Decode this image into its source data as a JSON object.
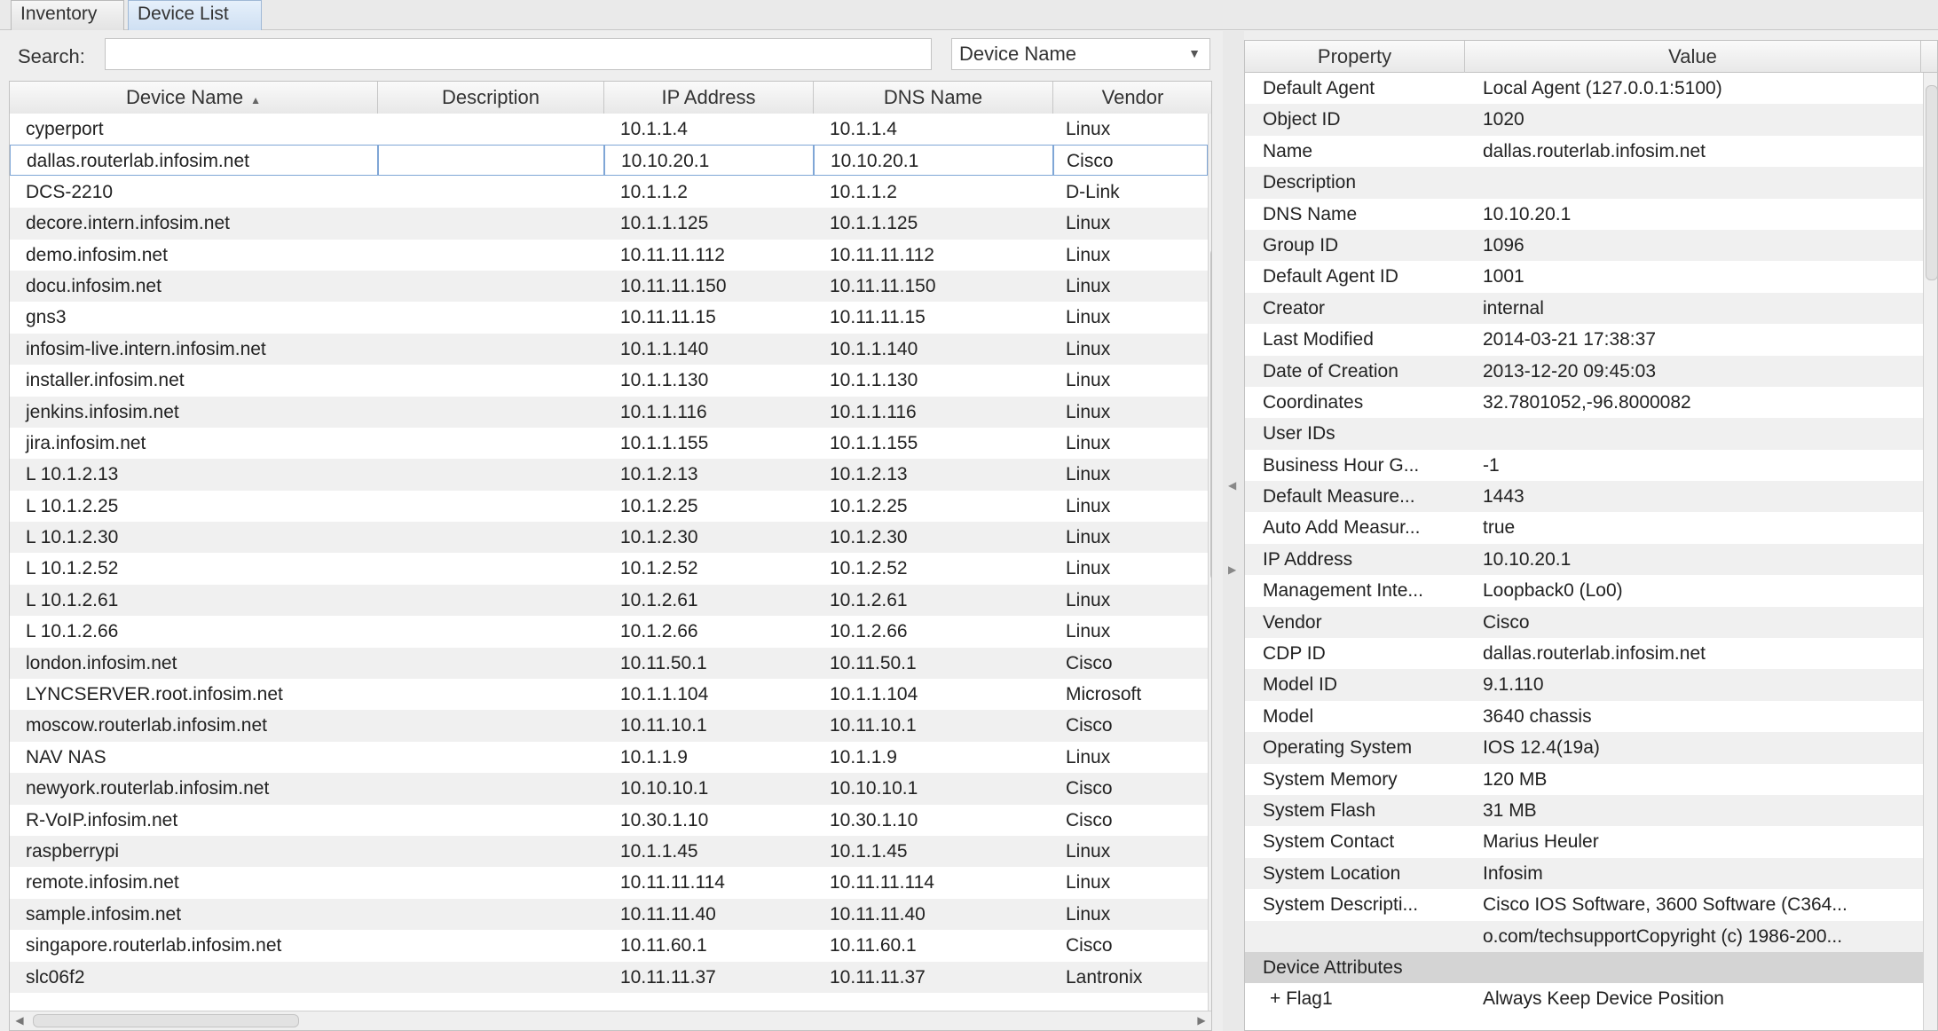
{
  "tabs": [
    {
      "label": "Inventory",
      "active": false
    },
    {
      "label": "Device List",
      "active": true
    }
  ],
  "search": {
    "label": "Search:",
    "value": "",
    "field": "Device Name"
  },
  "table": {
    "columns": [
      "Device Name",
      "Description",
      "IP Address",
      "DNS Name",
      "Vendor"
    ],
    "sort_indicator": "▲",
    "rows": [
      [
        "cyperport",
        "",
        "10.1.1.4",
        "10.1.1.4",
        "Linux"
      ],
      [
        "dallas.routerlab.infosim.net",
        "",
        "10.10.20.1",
        "10.10.20.1",
        "Cisco"
      ],
      [
        "DCS-2210",
        "",
        "10.1.1.2",
        "10.1.1.2",
        "D-Link"
      ],
      [
        "decore.intern.infosim.net",
        "",
        "10.1.1.125",
        "10.1.1.125",
        "Linux"
      ],
      [
        "demo.infosim.net",
        "",
        "10.11.11.112",
        "10.11.11.112",
        "Linux"
      ],
      [
        "docu.infosim.net",
        "",
        "10.11.11.150",
        "10.11.11.150",
        "Linux"
      ],
      [
        "gns3",
        "",
        "10.11.11.15",
        "10.11.11.15",
        "Linux"
      ],
      [
        "infosim-live.intern.infosim.net",
        "",
        "10.1.1.140",
        "10.1.1.140",
        "Linux"
      ],
      [
        "installer.infosim.net",
        "",
        "10.1.1.130",
        "10.1.1.130",
        "Linux"
      ],
      [
        "jenkins.infosim.net",
        "",
        "10.1.1.116",
        "10.1.1.116",
        "Linux"
      ],
      [
        "jira.infosim.net",
        "",
        "10.1.1.155",
        "10.1.1.155",
        "Linux"
      ],
      [
        "L 10.1.2.13",
        "",
        "10.1.2.13",
        "10.1.2.13",
        "Linux"
      ],
      [
        "L 10.1.2.25",
        "",
        "10.1.2.25",
        "10.1.2.25",
        "Linux"
      ],
      [
        "L 10.1.2.30",
        "",
        "10.1.2.30",
        "10.1.2.30",
        "Linux"
      ],
      [
        "L 10.1.2.52",
        "",
        "10.1.2.52",
        "10.1.2.52",
        "Linux"
      ],
      [
        "L 10.1.2.61",
        "",
        "10.1.2.61",
        "10.1.2.61",
        "Linux"
      ],
      [
        "L 10.1.2.66",
        "",
        "10.1.2.66",
        "10.1.2.66",
        "Linux"
      ],
      [
        "london.infosim.net",
        "",
        "10.11.50.1",
        "10.11.50.1",
        "Cisco"
      ],
      [
        "LYNCSERVER.root.infosim.net",
        "",
        "10.1.1.104",
        "10.1.1.104",
        "Microsoft"
      ],
      [
        "moscow.routerlab.infosim.net",
        "",
        "10.11.10.1",
        "10.11.10.1",
        "Cisco"
      ],
      [
        "NAV NAS",
        "",
        "10.1.1.9",
        "10.1.1.9",
        "Linux"
      ],
      [
        "newyork.routerlab.infosim.net",
        "",
        "10.10.10.1",
        "10.10.10.1",
        "Cisco"
      ],
      [
        "R-VoIP.infosim.net",
        "",
        "10.30.1.10",
        "10.30.1.10",
        "Cisco"
      ],
      [
        "raspberrypi",
        "",
        "10.1.1.45",
        "10.1.1.45",
        "Linux"
      ],
      [
        "remote.infosim.net",
        "",
        "10.11.11.114",
        "10.11.11.114",
        "Linux"
      ],
      [
        "sample.infosim.net",
        "",
        "10.11.11.40",
        "10.11.11.40",
        "Linux"
      ],
      [
        "singapore.routerlab.infosim.net",
        "",
        "10.11.60.1",
        "10.11.60.1",
        "Cisco"
      ],
      [
        "slc06f2",
        "",
        "10.11.11.37",
        "10.11.11.37",
        "Lantronix"
      ]
    ],
    "selected_row": 1
  },
  "properties": {
    "columns": [
      "Property",
      "Value"
    ],
    "rows": [
      [
        "Default Agent",
        "Local Agent (127.0.0.1:5100)"
      ],
      [
        "Object ID",
        "1020"
      ],
      [
        "Name",
        "dallas.routerlab.infosim.net"
      ],
      [
        "Description",
        ""
      ],
      [
        "DNS Name",
        "10.10.20.1"
      ],
      [
        "Group ID",
        "1096"
      ],
      [
        "Default Agent ID",
        "1001"
      ],
      [
        "Creator",
        "internal"
      ],
      [
        "Last Modified",
        "2014-03-21 17:38:37"
      ],
      [
        "Date of Creation",
        "2013-12-20 09:45:03"
      ],
      [
        "Coordinates",
        "32.7801052,-96.8000082"
      ],
      [
        "User IDs",
        ""
      ],
      [
        "Business Hour G...",
        "-1"
      ],
      [
        "Default Measure...",
        "1443"
      ],
      [
        "Auto Add Measur...",
        "true"
      ],
      [
        "IP Address",
        "10.10.20.1"
      ],
      [
        "Management Inte...",
        "Loopback0 (Lo0)"
      ],
      [
        "Vendor",
        "Cisco"
      ],
      [
        "CDP ID",
        "dallas.routerlab.infosim.net"
      ],
      [
        "Model ID",
        "9.1.110"
      ],
      [
        "Model",
        "3640 chassis"
      ],
      [
        "Operating System",
        "IOS 12.4(19a)"
      ],
      [
        "System Memory",
        "120 MB"
      ],
      [
        "System Flash",
        "31 MB"
      ],
      [
        "System Contact",
        "Marius Heuler"
      ],
      [
        "System Location",
        "Infosim"
      ],
      [
        "System Descripti...",
        "Cisco IOS Software, 3600 Software (C364..."
      ],
      [
        "",
        "o.com/techsupportCopyright (c) 1986-200..."
      ]
    ],
    "section_label": "Device Attributes",
    "attribute_rows": [
      [
        "+ Flag1",
        "Always Keep Device Position"
      ]
    ]
  },
  "colors": {
    "selection_border": "#7fa6d6",
    "active_tab": "#cfe0f3",
    "section_bg": "#d4d4d4"
  }
}
